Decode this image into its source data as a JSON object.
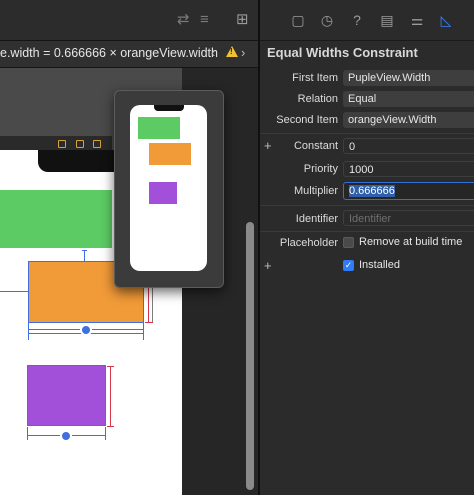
{
  "editor": {
    "breadcrumb": "e.width = 0.666666 × orangeView.width",
    "nav_prev": "‹",
    "nav_next": "›",
    "toolbar_icon_1": "⇄",
    "toolbar_icon_2": "≡",
    "toolbar_icon_3": "⊞"
  },
  "inspector": {
    "title": "Equal Widths Constraint",
    "tabs": [
      "file-icon",
      "history-icon",
      "help-icon",
      "identity-icon",
      "attributes-icon",
      "size-icon"
    ],
    "tab_glyphs": [
      "▢",
      "◷",
      "?",
      "▤",
      "⚌",
      "◺"
    ],
    "first_item_label": "First Item",
    "first_item_value": "PupleView.Width",
    "relation_label": "Relation",
    "relation_value": "Equal",
    "second_item_label": "Second Item",
    "second_item_value": "orangeView.Width",
    "constant_label": "Constant",
    "constant_value": "0",
    "priority_label": "Priority",
    "priority_value": "1000",
    "multiplier_label": "Multiplier",
    "multiplier_value": "0.666666",
    "identifier_label": "Identifier",
    "identifier_placeholder": "Identifier",
    "placeholder_label": "Placeholder",
    "remove_at_build_label": "Remove at build time",
    "installed_label": "Installed",
    "plus_glyph": "+",
    "check_glyph": "✓",
    "colors": {
      "accent": "#3b82f6",
      "green_view": "#5ccb63",
      "orange_view": "#f19a38",
      "purple_view": "#a24fd9"
    }
  }
}
